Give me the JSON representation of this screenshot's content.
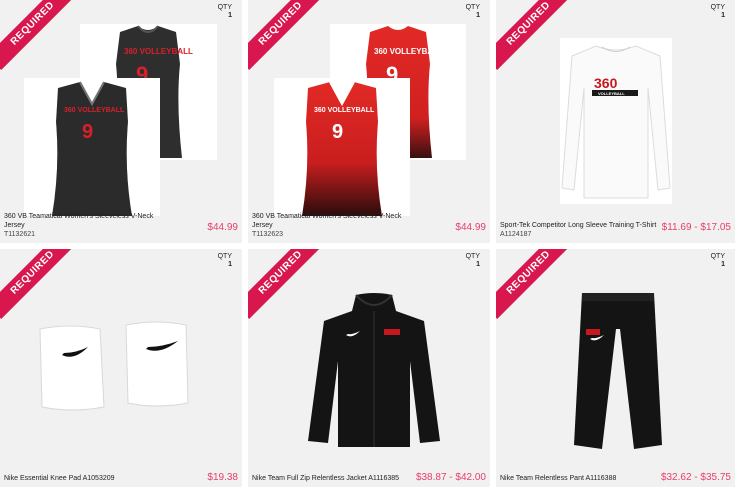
{
  "products": [
    {
      "badge": "REQUIRED",
      "qty_label": "QTY",
      "qty": "1",
      "name": "360 VB Teamatical Women's Sleeveless V-Neck Jersey",
      "sku": "T1132621",
      "price": "$44.99",
      "jersey_text": "360 VOLLEYBALL",
      "jersey_number": "9",
      "colors": {
        "primary": "#2b2b2b",
        "accent": "#d8202a"
      }
    },
    {
      "badge": "REQUIRED",
      "qty_label": "QTY",
      "qty": "1",
      "name": "360 VB Teamatical Women's Sleeveless V-Neck Jersey",
      "sku": "T1132623",
      "price": "$44.99",
      "jersey_text": "360 VOLLEYBALL",
      "jersey_number": "9",
      "colors": {
        "primary": "#e22a26",
        "accent": "#ffffff"
      }
    },
    {
      "badge": "REQUIRED",
      "qty_label": "QTY",
      "qty": "1",
      "name": "Sport-Tek Competitor Long Sleeve Training  T-Shirt",
      "sku": "A1124187",
      "price": "$11.69 - $17.05",
      "logo_big": "360",
      "logo_small": "VOLLEYBALL"
    },
    {
      "badge": "REQUIRED",
      "qty_label": "QTY",
      "qty": "1",
      "name": "Nike Essential Knee Pad   A1053209",
      "price": "$19.38"
    },
    {
      "badge": "REQUIRED",
      "qty_label": "QTY",
      "qty": "1",
      "name": "Nike Team Full Zip Relentless Jacket   A1116385",
      "price": "$38.87 - $42.00"
    },
    {
      "badge": "REQUIRED",
      "qty_label": "QTY",
      "qty": "1",
      "name": "Nike Team Relentless Pant   A1116388",
      "price": "$32.62 - $35.75"
    }
  ],
  "brand_colors": {
    "badge": "#d9174f",
    "price": "#e83e6a",
    "card_bg": "#f1f1f1"
  }
}
